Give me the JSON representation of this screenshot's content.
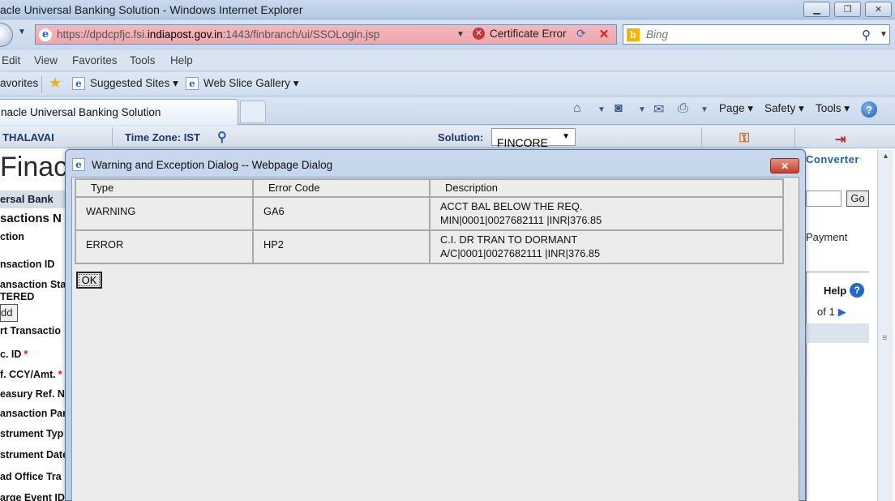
{
  "window": {
    "title": "acle Universal Banking Solution - Windows Internet Explorer"
  },
  "address_bar": {
    "url_prefix": "https://dpdcpfjc.fsi.",
    "url_domain": "indiapost.gov.in",
    "url_suffix": ":1443/finbranch/ui/SSOLogin.jsp",
    "certificate_label": "Certificate Error",
    "search_placeholder": "Bing"
  },
  "menu": [
    "Edit",
    "View",
    "Favorites",
    "Tools",
    "Help"
  ],
  "favorites_bar": {
    "label": "avorites",
    "items": [
      "Suggested Sites ▾",
      "Web Slice Gallery ▾"
    ]
  },
  "tab": {
    "title": "nacle Universal Banking Solution"
  },
  "command_bar": {
    "page": "Page ▾",
    "safety": "Safety ▾",
    "tools": "Tools ▾"
  },
  "finacle": {
    "user": "THALAVAI",
    "timezone": "Time Zone:  IST",
    "solution_label": "Solution:",
    "solution_value": "FINCORE",
    "brand": "Finac",
    "band_text": "ersal Bank",
    "right_link": "Converter",
    "go_label": "Go",
    "payment_label": "Payment",
    "help_label": "Help",
    "pager": "of 1",
    "add_label": "dd",
    "labels": [
      "sactions N",
      "ction",
      "nsaction ID",
      "ansaction Sta",
      "TERED",
      "rt Transactio",
      "c. ID",
      "f. CCY/Amt.",
      "easury Ref. N",
      "ansaction Par",
      "strument Typ",
      "strument Date",
      "ad Office Tra",
      "arge Event ID"
    ]
  },
  "dialog": {
    "title": "Warning and Exception Dialog -- Webpage Dialog",
    "columns": [
      "Type",
      "Error Code",
      "Description"
    ],
    "rows": [
      {
        "type": "WARNING",
        "code": "GA6",
        "desc_line1": "ACCT BAL BELOW THE REQ.",
        "desc_line2": "MIN|0001|0027682111 |INR|376.85"
      },
      {
        "type": "ERROR",
        "code": "HP2",
        "desc_line1": "C.I. DR TRAN TO DORMANT",
        "desc_line2": "A/C|0001|0027682111 |INR|376.85"
      }
    ],
    "ok_label": "OK"
  }
}
